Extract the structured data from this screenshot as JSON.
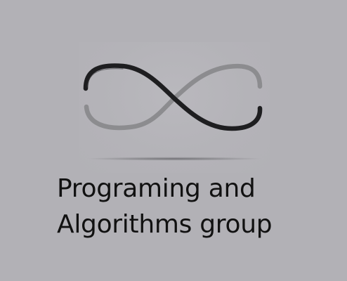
{
  "caption": {
    "line1": "Programing and",
    "line2": "Algorithms group"
  },
  "logo": {
    "icon": "infinity-ribbon-icon",
    "colors": {
      "dark_band": "#1e1e20",
      "light_band": "#8c8c8f",
      "shadow": "#6c6c70"
    }
  },
  "colors": {
    "background": "#b2b1b6",
    "text": "#111111"
  }
}
